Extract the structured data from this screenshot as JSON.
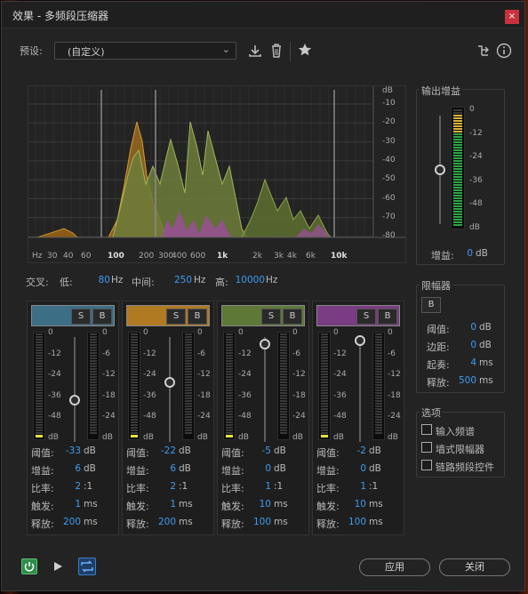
{
  "window": {
    "title": "效果 - 多频段压缩器",
    "close_glyph": "×"
  },
  "preset": {
    "label": "预设:",
    "value": "(自定义)"
  },
  "toolbar": {
    "icons": [
      "download-icon",
      "trash-icon",
      "star-icon",
      "route-icon",
      "info-icon"
    ]
  },
  "graph": {
    "db_unit": "dB",
    "db_ticks": [
      "-10",
      "-20",
      "-30",
      "-40",
      "-50",
      "-60",
      "-70",
      "-80"
    ],
    "hz_unit": "Hz",
    "hz_ticks": [
      "30",
      "40",
      "60",
      "100",
      "200",
      "300",
      "400",
      "600",
      "1k",
      "2k",
      "3k",
      "4k",
      "6k",
      "10k"
    ]
  },
  "crossover": {
    "label": "交叉:",
    "low_label": "低:",
    "low": "80",
    "mid_label": "中间:",
    "mid": "250",
    "high_label": "高:",
    "high": "10000",
    "unit": "Hz"
  },
  "output_gain": {
    "title": "输出增益",
    "scale": [
      "0",
      "-12",
      "-24",
      "-36",
      "-48",
      "dB"
    ],
    "gain_label": "增益:",
    "gain": "0",
    "unit": "dB"
  },
  "limiter": {
    "title": "限幅器",
    "bypass": "B",
    "rows": [
      {
        "label": "阈值:",
        "value": "0",
        "unit": "dB"
      },
      {
        "label": "边距:",
        "value": "0",
        "unit": "dB"
      },
      {
        "label": "起奏:",
        "value": "4",
        "unit": "ms"
      },
      {
        "label": "释放:",
        "value": "500",
        "unit": "ms"
      }
    ]
  },
  "options": {
    "title": "选项",
    "items": [
      "输入频谱",
      "墙式限幅器",
      "链路频段控件"
    ]
  },
  "bands": [
    {
      "color": "#3c6e86",
      "solo": "S",
      "bypass": "B",
      "level": 0.4,
      "rows": [
        {
          "label": "阈值:",
          "value": "-33",
          "unit": "dB"
        },
        {
          "label": "增益:",
          "value": "6",
          "unit": "dB"
        },
        {
          "label": "比率:",
          "value": "2",
          "unit": ":1"
        },
        {
          "label": "触发:",
          "value": "1",
          "unit": "ms"
        },
        {
          "label": "释放:",
          "value": "200",
          "unit": "ms"
        }
      ]
    },
    {
      "color": "#b07a22",
      "solo": "S",
      "bypass": "B",
      "level": 0.57,
      "rows": [
        {
          "label": "阈值:",
          "value": "-22",
          "unit": "dB"
        },
        {
          "label": "增益:",
          "value": "6",
          "unit": "dB"
        },
        {
          "label": "比率:",
          "value": "2",
          "unit": ":1"
        },
        {
          "label": "触发:",
          "value": "1",
          "unit": "ms"
        },
        {
          "label": "释放:",
          "value": "200",
          "unit": "ms"
        }
      ]
    },
    {
      "color": "#5e7838",
      "solo": "S",
      "bypass": "B",
      "level": 0.93,
      "rows": [
        {
          "label": "阈值:",
          "value": "-5",
          "unit": "dB"
        },
        {
          "label": "增益:",
          "value": "0",
          "unit": "dB"
        },
        {
          "label": "比率:",
          "value": "1",
          "unit": ":1"
        },
        {
          "label": "触发:",
          "value": "10",
          "unit": "ms"
        },
        {
          "label": "释放:",
          "value": "100",
          "unit": "ms"
        }
      ]
    },
    {
      "color": "#7a3c82",
      "solo": "S",
      "bypass": "B",
      "level": 0.97,
      "rows": [
        {
          "label": "阈值:",
          "value": "-2",
          "unit": "dB"
        },
        {
          "label": "增益:",
          "value": "0",
          "unit": "dB"
        },
        {
          "label": "比率:",
          "value": "1",
          "unit": ":1"
        },
        {
          "label": "触发:",
          "value": "10",
          "unit": "ms"
        },
        {
          "label": "释放:",
          "value": "100",
          "unit": "ms"
        }
      ]
    }
  ],
  "band_scale_left": [
    "0",
    "-12",
    "-24",
    "-36",
    "-48",
    "dB"
  ],
  "band_scale_right": [
    "0",
    "-6",
    "-12",
    "-18",
    "-24",
    "dB"
  ],
  "footer": {
    "apply": "应用",
    "close": "关闭"
  }
}
